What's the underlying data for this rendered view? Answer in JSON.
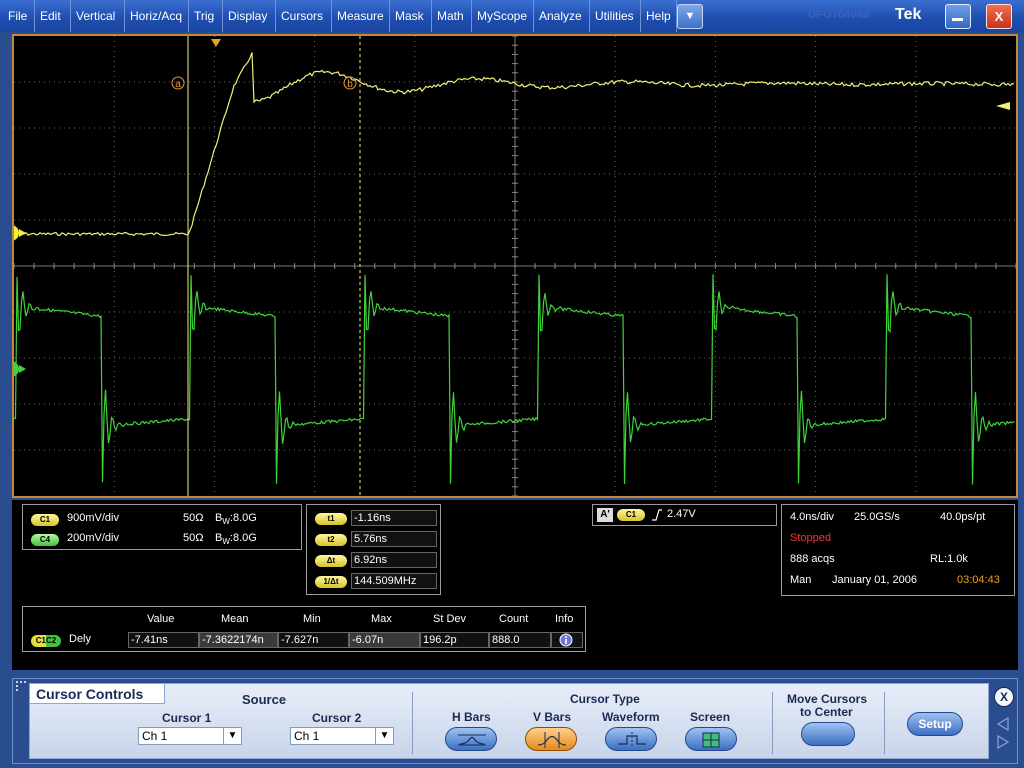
{
  "menu": {
    "items": [
      "File",
      "Edit",
      "Vertical",
      "Horiz/Acq",
      "Trig",
      "Display",
      "Cursors",
      "Measure",
      "Mask",
      "Math",
      "MyScope",
      "Analyze",
      "Utilities",
      "Help"
    ],
    "dropdown_icon": "triangle-down",
    "logo": "Tek",
    "logo_ghost": "DPO70404B",
    "minimize_icon": "minimize",
    "close_label": "X"
  },
  "display": {
    "markers": {
      "cursor_a": "a",
      "cursor_b": "b",
      "ch1": "1",
      "ch4": "4"
    },
    "colors": {
      "ch1": "#f2ee7a",
      "ch4": "#3fd43a",
      "cursor_label": "#e89a3a"
    }
  },
  "channels": [
    {
      "badge": "C1",
      "scale": "900mV/div",
      "impedance": "50Ω",
      "bw_prefix": "B",
      "bw_sub": "W",
      "bw": ":8.0G"
    },
    {
      "badge": "C4",
      "scale": "200mV/div",
      "impedance": "50Ω",
      "bw_prefix": "B",
      "bw_sub": "W",
      "bw": ":8.0G"
    }
  ],
  "cursors": {
    "t1": {
      "label": "t1",
      "value": "-1.16ns"
    },
    "t2": {
      "label": "t2",
      "value": "5.76ns"
    },
    "dt": {
      "label": "Δt",
      "value": "6.92ns"
    },
    "inv": {
      "label": "1/Δt",
      "value": "144.509MHz"
    }
  },
  "trigger": {
    "mode": "A'",
    "source": "C1",
    "slope_icon": "rising-edge",
    "level": "2.47V"
  },
  "timebase": {
    "scale": "4.0ns/div",
    "rate": "25.0GS/s",
    "resolution": "40.0ps/pt",
    "status": "Stopped",
    "acqs": "888 acqs",
    "record": "RL:1.0k",
    "mode": "Man",
    "date": "January 01, 2006",
    "time": "03:04:43"
  },
  "measurement": {
    "headers": [
      "Value",
      "Mean",
      "Min",
      "Max",
      "St Dev",
      "Count",
      "Info"
    ],
    "source": "C1C2",
    "name": "Dely",
    "values": [
      "-7.41ns",
      "-7.3622174n",
      "-7.627n",
      "-6.07n",
      "196.2p",
      "888.0"
    ],
    "info_icon": "info"
  },
  "cursor_controls": {
    "title": "Cursor Controls",
    "source_label": "Source",
    "cursor1_label": "Cursor 1",
    "cursor2_label": "Cursor 2",
    "cursor1_value": "Ch 1",
    "cursor2_value": "Ch 1",
    "type_label": "Cursor Type",
    "types": [
      "H Bars",
      "V Bars",
      "Waveform",
      "Screen"
    ],
    "selected_type": "V Bars",
    "move_label_1": "Move Cursors",
    "move_label_2": "to Center",
    "setup_label": "Setup",
    "close_label": "X"
  }
}
